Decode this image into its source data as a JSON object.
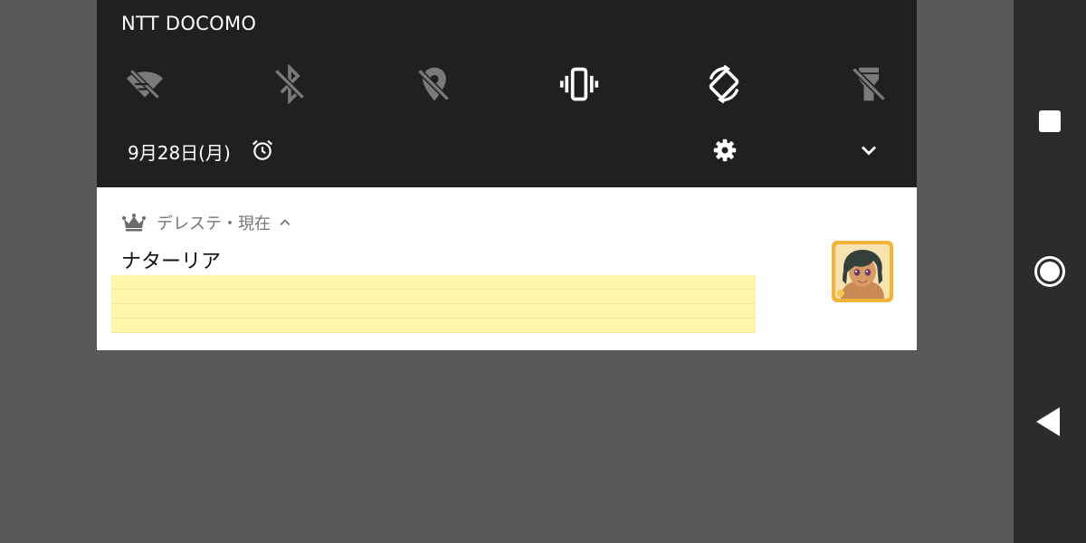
{
  "status": {
    "carrier": "NTT DOCOMO",
    "date": "9月28日(月)"
  },
  "quick_tiles": [
    {
      "icon": "wifi-off-icon",
      "state": "off"
    },
    {
      "icon": "bluetooth-off-icon",
      "state": "off"
    },
    {
      "icon": "location-off-icon",
      "state": "off"
    },
    {
      "icon": "vibrate-icon",
      "state": "on"
    },
    {
      "icon": "auto-rotate-icon",
      "state": "on"
    },
    {
      "icon": "flashlight-off-icon",
      "state": "off"
    }
  ],
  "notification": {
    "app_name": "デレステ・現在",
    "title": "ナターリア",
    "body": ""
  },
  "colors": {
    "shade_bg": "#202020",
    "tile_on": "#ffffff",
    "tile_off": "#7a7a7a",
    "body_highlight": "#fff6ac",
    "avatar_frame": "#f2b53a"
  }
}
